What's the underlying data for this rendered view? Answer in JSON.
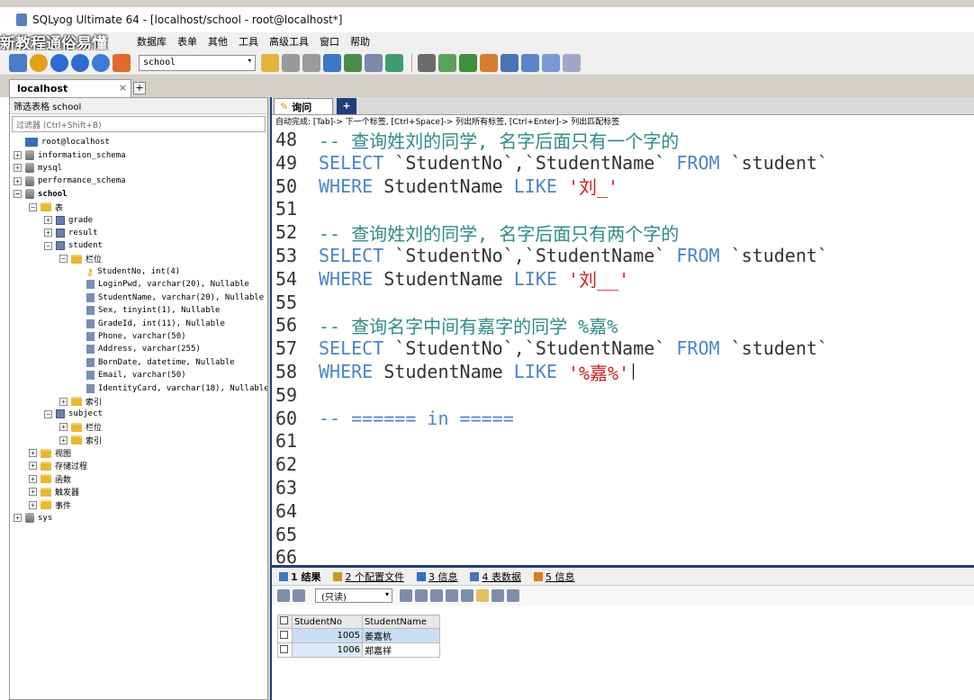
{
  "window": {
    "title": "SQLyog Ultimate 64 - [localhost/school - root@localhost*]"
  },
  "overlay": {
    "caption": "新教程通俗易懂"
  },
  "menu": {
    "items": [
      "数据库",
      "表单",
      "其他",
      "工具",
      "高级工具",
      "窗口",
      "帮助"
    ]
  },
  "toolbar": {
    "db_select": "school"
  },
  "connection_tab": {
    "label": "localhost",
    "close": "×",
    "add": "+"
  },
  "left_pane": {
    "header": "筛选表格 school",
    "filter_placeholder": "过滤器 (Ctrl+Shift+B)",
    "tree": [
      {
        "label": "root@localhost",
        "exp": "",
        "icon": "server",
        "indent": 0
      },
      {
        "label": "information_schema",
        "exp": "⊞",
        "icon": "db",
        "indent": 0
      },
      {
        "label": "mysql",
        "exp": "⊞",
        "icon": "db",
        "indent": 0
      },
      {
        "label": "performance_schema",
        "exp": "⊞",
        "icon": "db",
        "indent": 0
      },
      {
        "label": "school",
        "exp": "⊟",
        "icon": "db",
        "indent": 0,
        "bold": true
      },
      {
        "label": "表",
        "exp": "⊟",
        "icon": "folder",
        "indent": 1
      },
      {
        "label": "grade",
        "exp": "⊞",
        "icon": "table",
        "indent": 2
      },
      {
        "label": "result",
        "exp": "⊞",
        "icon": "table",
        "indent": 2
      },
      {
        "label": "student",
        "exp": "⊟",
        "icon": "table",
        "indent": 2
      },
      {
        "label": "栏位",
        "exp": "⊟",
        "icon": "folder",
        "indent": 3
      },
      {
        "label": "StudentNo, int(4)",
        "exp": "",
        "icon": "key",
        "indent": 4
      },
      {
        "label": "LoginPwd, varchar(20), Nullable",
        "exp": "",
        "icon": "col",
        "indent": 4
      },
      {
        "label": "StudentName, varchar(20), Nullable",
        "exp": "",
        "icon": "col",
        "indent": 4
      },
      {
        "label": "Sex, tinyint(1), Nullable",
        "exp": "",
        "icon": "col",
        "indent": 4
      },
      {
        "label": "GradeId, int(11), Nullable",
        "exp": "",
        "icon": "col",
        "indent": 4
      },
      {
        "label": "Phone, varchar(50)",
        "exp": "",
        "icon": "col",
        "indent": 4
      },
      {
        "label": "Address, varchar(255)",
        "exp": "",
        "icon": "col",
        "indent": 4
      },
      {
        "label": "BornDate, datetime, Nullable",
        "exp": "",
        "icon": "col",
        "indent": 4
      },
      {
        "label": "Email, varchar(50)",
        "exp": "",
        "icon": "col",
        "indent": 4
      },
      {
        "label": "IdentityCard, varchar(18), Nullable",
        "exp": "",
        "icon": "col",
        "indent": 4
      },
      {
        "label": "索引",
        "exp": "⊞",
        "icon": "folder",
        "indent": 3
      },
      {
        "label": "subject",
        "exp": "⊟",
        "icon": "table",
        "indent": 2
      },
      {
        "label": "栏位",
        "exp": "⊞",
        "icon": "folder",
        "indent": 3
      },
      {
        "label": "索引",
        "exp": "⊞",
        "icon": "folder",
        "indent": 3
      },
      {
        "label": "视图",
        "exp": "⊞",
        "icon": "folder",
        "indent": 1
      },
      {
        "label": "存储过程",
        "exp": "⊞",
        "icon": "folder",
        "indent": 1
      },
      {
        "label": "函数",
        "exp": "⊞",
        "icon": "folder",
        "indent": 1
      },
      {
        "label": "触发器",
        "exp": "⊞",
        "icon": "folder",
        "indent": 1
      },
      {
        "label": "事件",
        "exp": "⊞",
        "icon": "folder",
        "indent": 1
      },
      {
        "label": "sys",
        "exp": "⊞",
        "icon": "db",
        "indent": 0
      }
    ]
  },
  "query_tab": {
    "label": "询问",
    "add": "+"
  },
  "autocomplete_hint": "自动完成: [Tab]-> 下一个标签, [Ctrl+Space]-> 列出所有标签, [Ctrl+Enter]-> 列出匹配标签",
  "editor": {
    "lines": [
      {
        "n": "48",
        "parts": [
          {
            "t": "-- 查询姓刘的同学, 名字后面只有一个字的",
            "c": "cmt"
          }
        ]
      },
      {
        "n": "49",
        "parts": [
          {
            "t": "SELECT ",
            "c": "kw"
          },
          {
            "t": "`StudentNo`,`StudentName` ",
            "c": "code"
          },
          {
            "t": "FROM ",
            "c": "kw"
          },
          {
            "t": "`student`",
            "c": "code"
          }
        ]
      },
      {
        "n": "50",
        "parts": [
          {
            "t": "WHERE ",
            "c": "kw"
          },
          {
            "t": "StudentName ",
            "c": "code"
          },
          {
            "t": "LIKE ",
            "c": "kw"
          },
          {
            "t": "'刘_'",
            "c": "str"
          }
        ]
      },
      {
        "n": "51",
        "parts": []
      },
      {
        "n": "52",
        "parts": [
          {
            "t": "-- 查询姓刘的同学, 名字后面只有两个字的",
            "c": "cmt"
          }
        ]
      },
      {
        "n": "53",
        "parts": [
          {
            "t": "SELECT ",
            "c": "kw"
          },
          {
            "t": "`StudentNo`,`StudentName` ",
            "c": "code"
          },
          {
            "t": "FROM ",
            "c": "kw"
          },
          {
            "t": "`student`",
            "c": "code"
          }
        ]
      },
      {
        "n": "54",
        "parts": [
          {
            "t": "WHERE ",
            "c": "kw"
          },
          {
            "t": "StudentName ",
            "c": "code"
          },
          {
            "t": "LIKE ",
            "c": "kw"
          },
          {
            "t": "'刘__'",
            "c": "str"
          }
        ]
      },
      {
        "n": "55",
        "parts": []
      },
      {
        "n": "56",
        "parts": [
          {
            "t": "-- 查询名字中间有嘉字的同学 %嘉%",
            "c": "cmt"
          }
        ]
      },
      {
        "n": "57",
        "parts": [
          {
            "t": "SELECT ",
            "c": "kw"
          },
          {
            "t": "`StudentNo`,`StudentName` ",
            "c": "code"
          },
          {
            "t": "FROM ",
            "c": "kw"
          },
          {
            "t": "`student`",
            "c": "code"
          }
        ]
      },
      {
        "n": "58",
        "parts": [
          {
            "t": "WHERE ",
            "c": "kw"
          },
          {
            "t": "StudentName ",
            "c": "code"
          },
          {
            "t": "LIKE ",
            "c": "kw"
          },
          {
            "t": "'%嘉%'",
            "c": "str"
          }
        ],
        "cursor": true
      },
      {
        "n": "59",
        "parts": []
      },
      {
        "n": "60",
        "parts": [
          {
            "t": "-- ====== in =====",
            "c": "kw"
          }
        ]
      },
      {
        "n": "61",
        "parts": []
      },
      {
        "n": "62",
        "parts": []
      },
      {
        "n": "63",
        "parts": []
      },
      {
        "n": "64",
        "parts": []
      },
      {
        "n": "65",
        "parts": []
      },
      {
        "n": "66",
        "parts": []
      }
    ]
  },
  "results": {
    "tabs": [
      {
        "label": "1 结果",
        "active": true
      },
      {
        "label": "2 个配置文件",
        "active": false
      },
      {
        "label": "3 信息",
        "active": false
      },
      {
        "label": "4 表数据",
        "active": false
      },
      {
        "label": "5 信息",
        "active": false
      }
    ],
    "mode_select": "(只读)",
    "columns": [
      "StudentNo",
      "StudentName"
    ],
    "rows": [
      [
        "1005",
        "姜嘉杭"
      ],
      [
        "1006",
        "郑嘉祥"
      ]
    ]
  }
}
